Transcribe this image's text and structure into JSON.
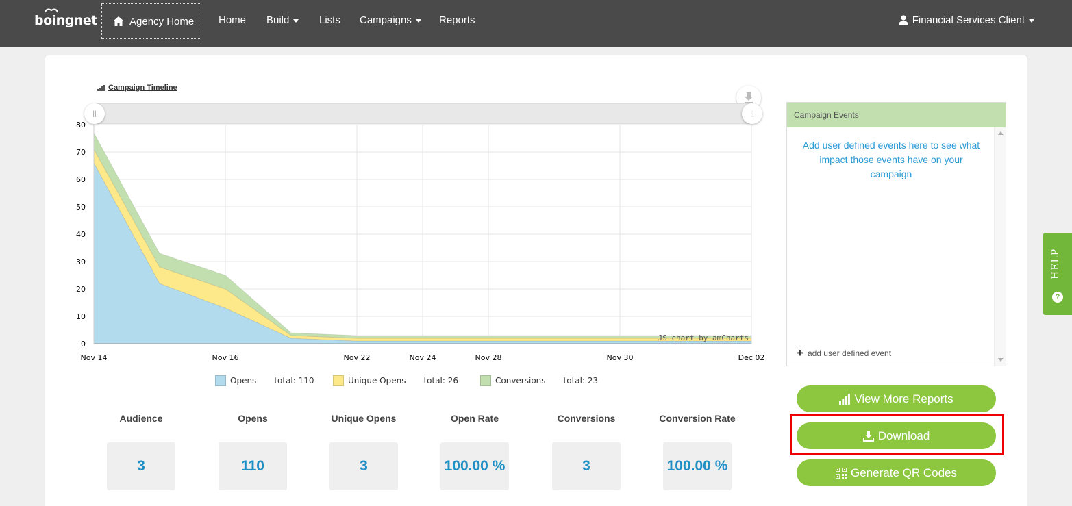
{
  "nav": {
    "logo": "boingnet",
    "agency_home": "Agency Home",
    "items": [
      "Home",
      "Build",
      "Lists",
      "Campaigns",
      "Reports"
    ],
    "user": "Financial Services Client"
  },
  "chart_title": "Campaign Timeline",
  "chart_data": {
    "type": "area",
    "stacked": true,
    "title": "Campaign Timeline",
    "x_ticks": [
      "Nov 14",
      "Nov 16",
      "Nov 22",
      "Nov 24",
      "Nov 28",
      "Nov 30",
      "Dec 02"
    ],
    "y_ticks": [
      0,
      10,
      20,
      30,
      40,
      50,
      60,
      70,
      80
    ],
    "ylim": [
      0,
      80
    ],
    "watermark": "JS chart by amCharts",
    "series": [
      {
        "name": "Opens",
        "color": "#b2dbee",
        "values": [
          66,
          22,
          13,
          2,
          1,
          1,
          1,
          1,
          1,
          1,
          1
        ]
      },
      {
        "name": "Unique Opens",
        "color": "#fde98a",
        "values": [
          5,
          6,
          7,
          1,
          1,
          1,
          1,
          1,
          1,
          1,
          1
        ]
      },
      {
        "name": "Conversions",
        "color": "#c2dfb0",
        "values": [
          6,
          5,
          5,
          1,
          1,
          1,
          1,
          1,
          1,
          1,
          1
        ]
      }
    ]
  },
  "legend": [
    {
      "name": "Opens",
      "total": "total: 110",
      "color": "#b2dbee"
    },
    {
      "name": "Unique Opens",
      "total": "total: 26",
      "color": "#fde98a"
    },
    {
      "name": "Conversions",
      "total": "total: 23",
      "color": "#c2dfb0"
    }
  ],
  "stats": [
    {
      "label": "Audience",
      "value": "3"
    },
    {
      "label": "Opens",
      "value": "110"
    },
    {
      "label": "Unique Opens",
      "value": "3"
    },
    {
      "label": "Open Rate",
      "value": "100.00 %"
    },
    {
      "label": "Conversions",
      "value": "3"
    },
    {
      "label": "Conversion Rate",
      "value": "100.00 %"
    }
  ],
  "events": {
    "header": "Campaign Events",
    "message": "Add user defined events here to see what impact those events have on your campaign",
    "add": "add user defined event"
  },
  "buttons": {
    "view_reports": "View More Reports",
    "download": "Download",
    "qr": "Generate QR Codes"
  },
  "help": "HELP"
}
